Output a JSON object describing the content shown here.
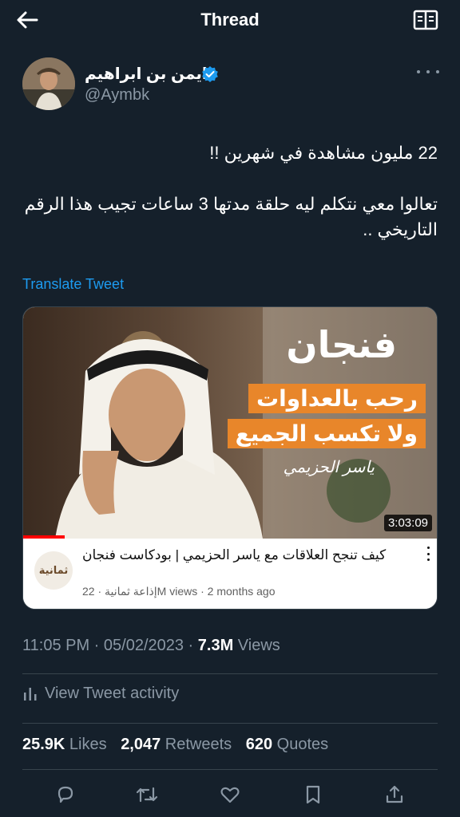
{
  "header": {
    "title": "Thread",
    "back_icon": "back-arrow-icon",
    "reader_icon": "reader-mode-icon"
  },
  "author": {
    "name": "ايمن بن ابراهيم",
    "handle": "@Aymbk",
    "verified": true
  },
  "tweet": {
    "lines": [
      "22 مليون مشاهدة في شهرين !!",
      "تعالوا معي نتكلم ليه حلقة مدتها 3 ساعات تجيب هذا الرقم التاريخي .."
    ],
    "translate_label": "Translate Tweet"
  },
  "card": {
    "thumbnail_title": "فنجان",
    "thumbnail_band1": "رحب بالعداوات",
    "thumbnail_band2": "ولا تكسب الجميع",
    "thumbnail_signature": "ياسر الحزيمي",
    "duration": "3:03:09",
    "channel_logo_text": "ثمانية",
    "video_title": "كيف تنجح العلاقات مع ياسر الحزيمي | بودكاست فنجان",
    "video_meta": "إذاعة ثمانية · 22M views · 2 months ago",
    "watch_progress": 0.1
  },
  "meta": {
    "time": "11:05 PM · 05/02/2023 · ",
    "views_count": "7.3M",
    "views_label": " Views",
    "activity_label": "View Tweet activity"
  },
  "stats": {
    "likes_count": "25.9K",
    "likes_label": " Likes",
    "retweets_count": "2,047",
    "retweets_label": " Retweets",
    "quotes_count": "620",
    "quotes_label": " Quotes"
  },
  "colors": {
    "background": "#15202b",
    "accent": "#1d9bf0",
    "secondary_text": "#8b98a5",
    "band_orange": "#e8862a"
  }
}
